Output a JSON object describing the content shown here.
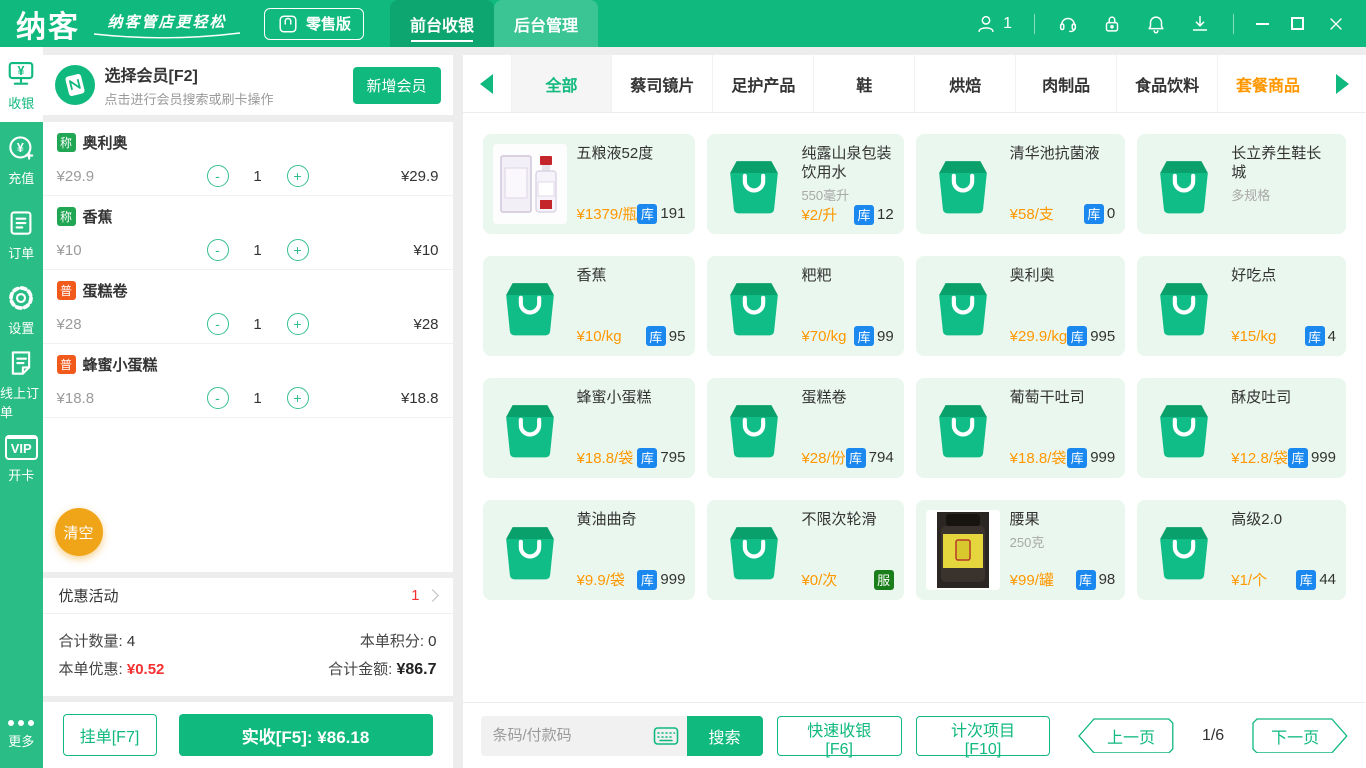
{
  "topbar": {
    "logo": "纳客",
    "slogan": "纳客管店更轻松",
    "edition": "零售版",
    "tabs": [
      {
        "label": "前台收银"
      },
      {
        "label": "后台管理"
      }
    ],
    "user_count": "1"
  },
  "sidebar": {
    "items": [
      {
        "label": "收银"
      },
      {
        "label": "充值"
      },
      {
        "label": "订单"
      },
      {
        "label": "设置"
      },
      {
        "label": "线上订单"
      },
      {
        "label": "开卡",
        "icon_text": "VIP"
      },
      {
        "label": "更多"
      }
    ]
  },
  "member_panel": {
    "title": "选择会员[F2]",
    "hint": "点击进行会员搜索或刷卡操作",
    "add_member": "新增会员"
  },
  "cart": {
    "items": [
      {
        "badge": "称",
        "name": "奥利奥",
        "price": "¥29.9",
        "qty": "1",
        "total": "¥29.9"
      },
      {
        "badge": "称",
        "name": "香蕉",
        "price": "¥10",
        "qty": "1",
        "total": "¥10"
      },
      {
        "badge": "普",
        "name": "蛋糕卷",
        "price": "¥28",
        "qty": "1",
        "total": "¥28"
      },
      {
        "badge": "普",
        "name": "蜂蜜小蛋糕",
        "price": "¥18.8",
        "qty": "1",
        "total": "¥18.8"
      }
    ],
    "clear": "清空",
    "promo_label": "优惠活动",
    "promo_count": "1",
    "summary": {
      "qty_label": "合计数量:",
      "qty_value": "4",
      "points_label": "本单积分:",
      "points_value": "0",
      "discount_label": "本单优惠:",
      "discount_value": "¥0.52",
      "total_label": "合计金额:",
      "total_value": "¥86.7"
    },
    "hold": "挂单[F7]",
    "pay": "实收[F5]: ¥86.18"
  },
  "categories": {
    "tabs": [
      {
        "label": "全部"
      },
      {
        "label": "蔡司镜片"
      },
      {
        "label": "足护产品"
      },
      {
        "label": "鞋"
      },
      {
        "label": "烘焙"
      },
      {
        "label": "肉制品"
      },
      {
        "label": "食品饮料"
      },
      {
        "label": "套餐商品"
      }
    ]
  },
  "badges": {
    "stock": "库",
    "service": "服"
  },
  "products": [
    {
      "name": "五粮液52度",
      "price": "¥1379/瓶",
      "stock": "191"
    },
    {
      "name": "纯露山泉包装饮用水",
      "spec": "550毫升",
      "price": "¥2/升",
      "stock": "12"
    },
    {
      "name": "清华池抗菌液",
      "price": "¥58/支",
      "stock": "0"
    },
    {
      "name": "长立养生鞋长城",
      "spec": "多规格"
    },
    {
      "name": "香蕉",
      "price": "¥10/kg",
      "stock": "95"
    },
    {
      "name": "粑粑",
      "price": "¥70/kg",
      "stock": "99"
    },
    {
      "name": "奥利奥",
      "price": "¥29.9/kg",
      "stock": "995"
    },
    {
      "name": "好吃点",
      "price": "¥15/kg",
      "stock": "4"
    },
    {
      "name": "蜂蜜小蛋糕",
      "price": "¥18.8/袋",
      "stock": "795"
    },
    {
      "name": "蛋糕卷",
      "price": "¥28/份",
      "stock": "794"
    },
    {
      "name": "葡萄干吐司",
      "price": "¥18.8/袋",
      "stock": "999"
    },
    {
      "name": "酥皮吐司",
      "price": "¥12.8/袋",
      "stock": "999"
    },
    {
      "name": "黄油曲奇",
      "price": "¥9.9/袋",
      "stock": "999"
    },
    {
      "name": "不限次轮滑",
      "price": "¥0/次"
    },
    {
      "name": "腰果",
      "spec": "250克",
      "price": "¥99/罐",
      "stock": "98"
    },
    {
      "name": "高级2.0",
      "price": "¥1/个",
      "stock": "44"
    }
  ],
  "bottom_bar": {
    "search_placeholder": "条码/付款码",
    "search": "搜索",
    "quick_cashier": "快速收银[F6]",
    "counting_item": "计次项目[F10]",
    "prev": "上一页",
    "page": "1/6",
    "next": "下一页"
  },
  "colors": {
    "header_green": "#10b97d",
    "sidebar_green": "#2abd86",
    "price_orange": "#ff9800",
    "stock_blue": "#1b88f0",
    "service_green": "#1a7f1a",
    "weigh_badge_green": "#21a654",
    "normal_badge_orange": "#f25a1c",
    "clear_orange": "#f0a418",
    "danger_red": "#f53030"
  }
}
